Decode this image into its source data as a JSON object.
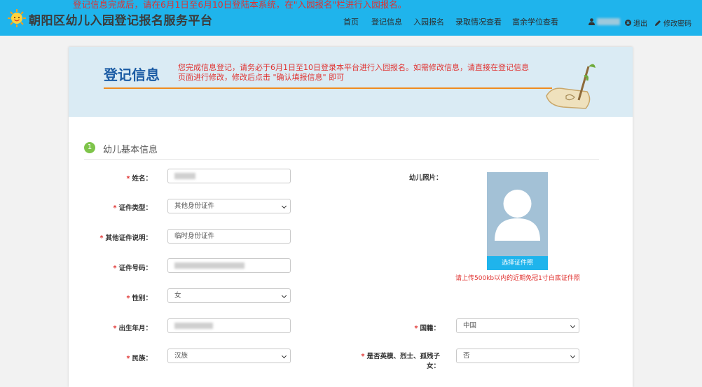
{
  "announcement": "登记信息完成后，请在6月1日至6月10日登陆本系统，在\"入园报名\"栏进行入园报名。",
  "header": {
    "title": "朝阳区幼儿入园登记报名服务平台",
    "nav": [
      "首页",
      "登记信息",
      "入园报名",
      "录取情况查看",
      "富余学位查看"
    ],
    "logout_label": "退出",
    "change_password_label": "修改密码"
  },
  "banner": {
    "title": "登记信息",
    "note": "您完成信息登记，请务必于6月1日至10日登录本平台进行入园报名。如需修改信息，请直接在登记信息页面进行修改，修改后点击 \"确认填报信息\" 即可"
  },
  "section": {
    "number": "1",
    "title": "幼儿基本信息"
  },
  "form": {
    "name_label": "姓名：",
    "id_type_label": "证件类型：",
    "id_type_value": "其他身份证件",
    "other_id_desc_label": "其他证件说明：",
    "other_id_desc_value": "临时身份证件",
    "id_number_label": "证件号码：",
    "gender_label": "性别：",
    "gender_value": "女",
    "birth_label": "出生年月：",
    "ethnicity_label": "民族：",
    "ethnicity_value": "汉族",
    "photo_label": "幼儿照片：",
    "nationality_label": "国籍：",
    "nationality_value": "中国",
    "hero_label_1": "是否英模、烈士、孤残子",
    "hero_label_2": "女：",
    "hero_value": "否"
  },
  "photo": {
    "button_label": "选择证件照",
    "note": "请上传500kb以内的近期免冠1寸白底证件照"
  },
  "colors": {
    "accent": "#1fb4ec",
    "title_blue": "#1c5ca4",
    "required_red": "#e0312f",
    "banner_bg": "#daebf4"
  }
}
